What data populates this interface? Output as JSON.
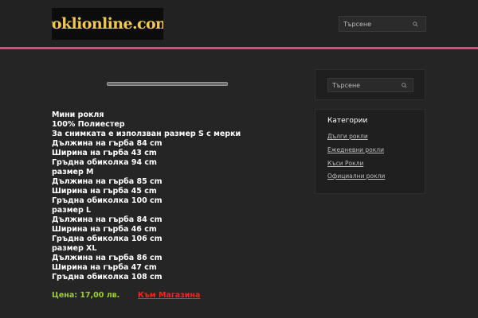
{
  "header": {
    "logo_text": "roklionline.com",
    "search_placeholder": "Търсене"
  },
  "content": {
    "lines": [
      "Мини рокля",
      "100% Полиестер",
      "За снимката е използван размер S с мерки",
      "Дължина на гърба 84 cm",
      "Ширина на гърба 43 cm",
      "Гръдна обиколка 94 cm",
      "размер M",
      "Дължина на гърба 85 cm",
      "Ширина на гърба 45 cm",
      "Гръдна обиколка 100 cm",
      "размер L",
      "Дължина на гърба 84 cm",
      "Ширина на гърба 46 cm",
      "Гръдна обиколка 106 cm",
      "размер XL",
      "Дължина на гърба 86 cm",
      "Ширина на гърба 47 cm",
      "Гръдна обиколка 108 cm"
    ],
    "price": "Цена: 17,00 лв.",
    "shop_link": "Към Магазина"
  },
  "sidebar": {
    "search_placeholder": "Търсене",
    "categories_title": "Категории",
    "categories": [
      "Дълги рокли",
      "Ежедневни рокли",
      "Къси Рокли",
      "Официални рокли"
    ]
  },
  "colors": {
    "accent_line": "#e0457b",
    "price": "#9ed02a",
    "link": "#ff2020",
    "logo_text": "#f2c84b"
  },
  "icons": {
    "search": "search-icon"
  }
}
